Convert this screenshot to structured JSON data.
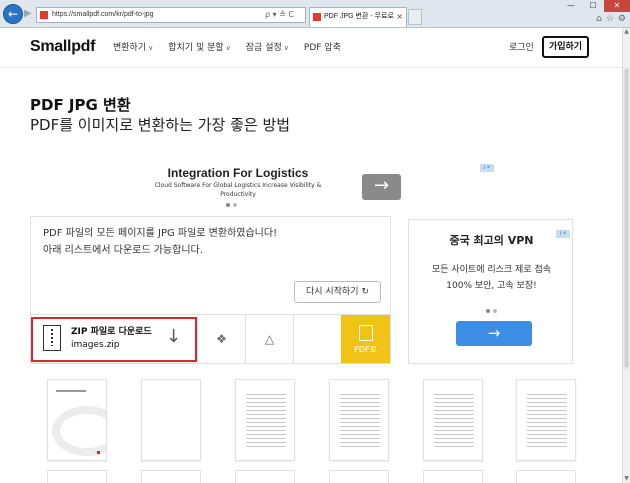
{
  "browser": {
    "url": "https://smallpdf.com/kr/pdf-to-jpg",
    "address_controls": "ρ ▾ ≙ C",
    "tab_title": "PDF JPG 변환 - 무료로 온...",
    "tab_close": "×",
    "win_min": "—",
    "win_max": "☐",
    "win_close": "✕",
    "toolbar_home": "⌂",
    "toolbar_fav": "☆",
    "toolbar_settings": "⚙"
  },
  "header": {
    "logo": "Smallpdf",
    "nav": [
      {
        "label": "변환하기",
        "chev": "∨"
      },
      {
        "label": "합치기 및 분할",
        "chev": "∨"
      },
      {
        "label": "잠금 설정",
        "chev": "∨"
      },
      {
        "label": "PDF 압축",
        "chev": ""
      }
    ],
    "login": "로그인",
    "signup": "가입하기"
  },
  "hero": {
    "title": "PDF JPG 변환",
    "subtitle": "PDF를 이미지로 변환하는 가장 좋은 방법"
  },
  "ad_top": {
    "title": "Integration For Logistics",
    "subtitle": "Cloud Software For Global Logistics Increase Visibility & Productivity",
    "badge": "i ×",
    "arrow": "→"
  },
  "result": {
    "message": "PDF 파일의 모든 페이지를 JPG 파일로 변환하였습니다! 아래 리스트에서 다운로드 가능합니다.",
    "restart_label": "다시 시작하기",
    "restart_icon": "↻",
    "download_title": "ZIP 파일로 다운로드",
    "download_file": "images.zip",
    "download_arrow": "↓",
    "dropbox_icon": "❖",
    "drive_icon": "△",
    "pdf_label": "PDF로"
  },
  "ad_side": {
    "title": "중국 최고의 VPN",
    "body": "모든 사이트에 리스크 제로 접속 100% 보안, 고속 보장!",
    "badge": "i ×",
    "arrow": "→"
  },
  "scroll": {
    "up": "▲",
    "down": "▼"
  },
  "colors": {
    "accent_red": "#d9272e",
    "pdf_yellow": "#f2c317",
    "ad_blue": "#3d8fe6"
  }
}
